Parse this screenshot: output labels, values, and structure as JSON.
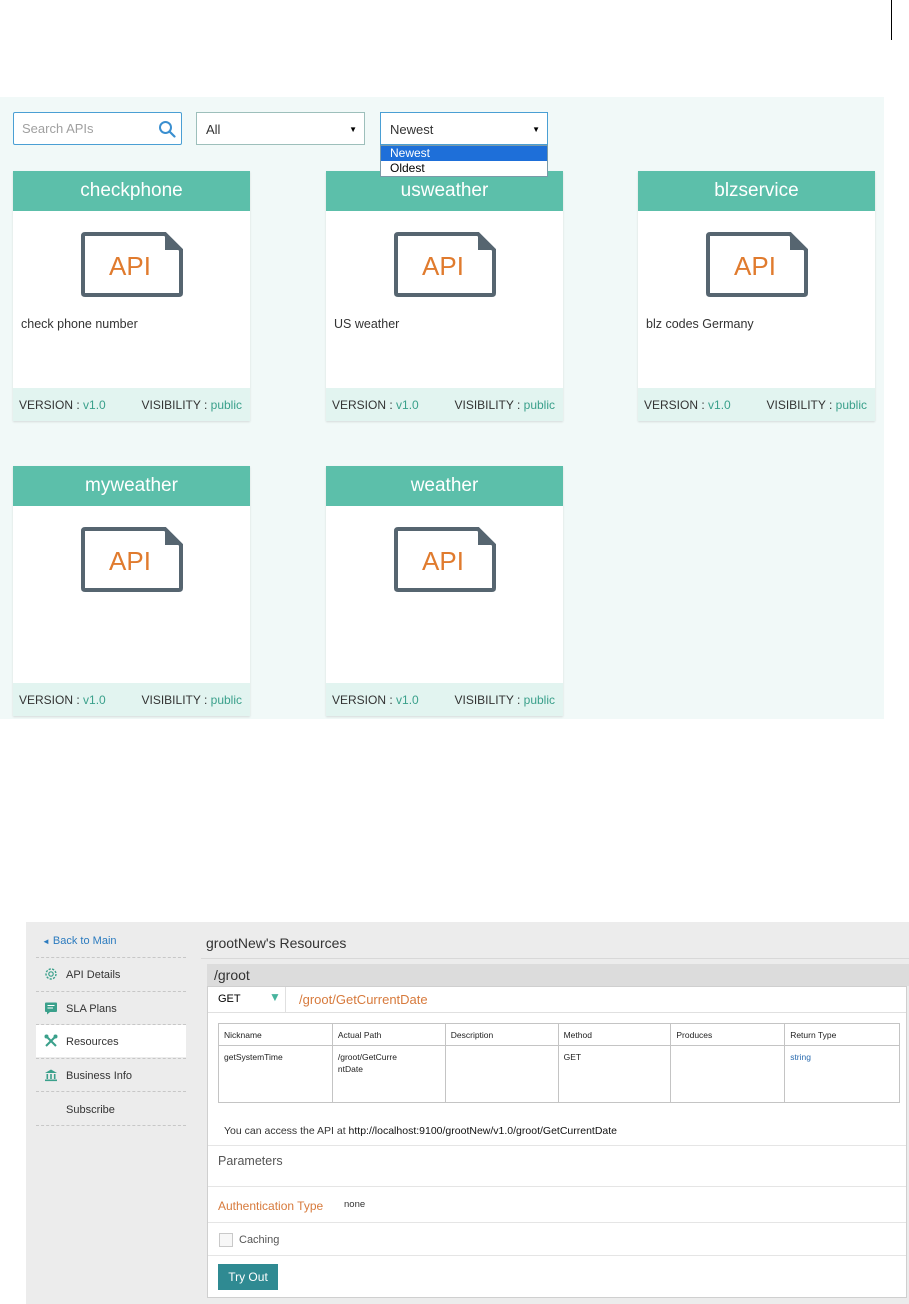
{
  "catalog": {
    "search": {
      "placeholder": "Search APIs"
    },
    "filter": {
      "selected": "All"
    },
    "sort": {
      "selected": "Newest",
      "options": [
        "Newest",
        "Oldest"
      ]
    },
    "icon_text": "API",
    "cards": [
      {
        "name": "checkphone",
        "description": "check phone number",
        "version_label": "VERSION : ",
        "version": "v1.0",
        "visibility_label": "VISIBILITY : ",
        "visibility": "public"
      },
      {
        "name": "usweather",
        "description": "US weather",
        "version_label": "VERSION : ",
        "version": "v1.0",
        "visibility_label": "VISIBILITY : ",
        "visibility": "public"
      },
      {
        "name": "blzservice",
        "description": "blz codes Germany",
        "version_label": "VERSION : ",
        "version": "v1.0",
        "visibility_label": "VISIBILITY : ",
        "visibility": "public"
      },
      {
        "name": "myweather",
        "description": "",
        "version_label": "VERSION : ",
        "version": "v1.0",
        "visibility_label": "VISIBILITY : ",
        "visibility": "public"
      },
      {
        "name": "weather",
        "description": "",
        "version_label": "VERSION : ",
        "version": "v1.0",
        "visibility_label": "VISIBILITY : ",
        "visibility": "public"
      }
    ]
  },
  "resources": {
    "sidebar": {
      "back": "Back to Main",
      "items": [
        {
          "label": "API Details",
          "icon": "gear-icon"
        },
        {
          "label": "SLA Plans",
          "icon": "sla-icon"
        },
        {
          "label": "Resources",
          "icon": "tools-icon",
          "active": true
        },
        {
          "label": "Business Info",
          "icon": "bank-icon"
        },
        {
          "label": "Subscribe",
          "icon": ""
        }
      ]
    },
    "title": "grootNew's Resources",
    "group": "/groot",
    "method": "GET",
    "path": "/groot/GetCurrentDate",
    "table": {
      "headers": [
        "Nickname",
        "Actual Path",
        "Description",
        "Method",
        "Produces",
        "Return Type"
      ],
      "row": {
        "nickname": "getSystemTime",
        "actual_path_1": "/groot/GetCurre",
        "actual_path_2": "ntDate",
        "description": "",
        "method": "GET",
        "produces": "",
        "return_type": "string"
      }
    },
    "access_prefix": "You can access the API at ",
    "access_url": "http://localhost:9100/grootNew/v1.0/groot/GetCurrentDate",
    "parameters_label": "Parameters",
    "auth_label": "Authentication Type",
    "auth_value": "none",
    "caching_label": "Caching",
    "try_label": "Try Out"
  },
  "colors": {
    "accent": "#5cbfaa",
    "link": "#2b7bbf",
    "orange": "#d77a3c",
    "button": "#2f8a92"
  }
}
